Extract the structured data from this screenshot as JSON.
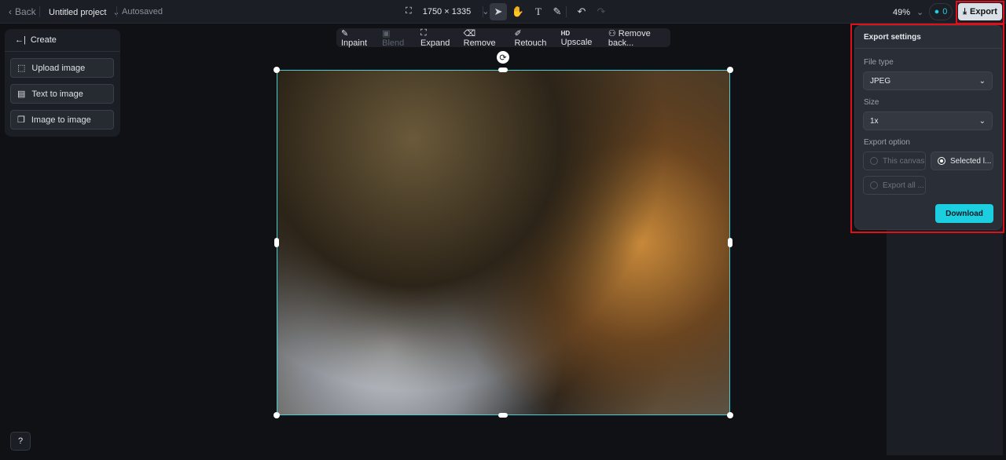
{
  "topbar": {
    "back": "Back",
    "project": "Untitled project",
    "status": "Autosaved",
    "dimensions": "1750 × 1335",
    "zoom": "49%",
    "credits": "0",
    "export": "Export"
  },
  "left_panel": {
    "title": "Create",
    "items": [
      "Upload image",
      "Text to image",
      "Image to image"
    ]
  },
  "edit_toolbar": {
    "items": [
      "Inpaint",
      "Blend",
      "Expand",
      "Remove",
      "Retouch",
      "Upscale",
      "Remove back..."
    ],
    "hd_badge": "HD"
  },
  "export_popup": {
    "title": "Export settings",
    "file_type_label": "File type",
    "file_type": "JPEG",
    "size_label": "Size",
    "size": "1x",
    "export_option_label": "Export option",
    "options": [
      "This canvas",
      "Selected l...",
      "Export all ..."
    ],
    "selected_option": "Selected l...",
    "download": "Download"
  },
  "colors": {
    "accent": "#1ccfe0",
    "selection": "#3fd0d8",
    "highlight": "#e0101a"
  }
}
